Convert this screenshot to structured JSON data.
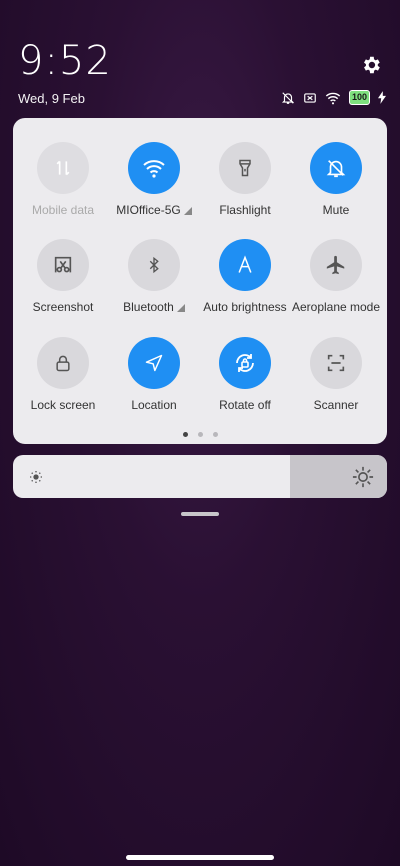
{
  "status": {
    "time": "9:52",
    "date": "Wed, 9 Feb",
    "battery": "100",
    "icons": [
      "mute-icon",
      "no-sim-icon",
      "wifi-icon",
      "battery-icon",
      "charging-icon"
    ]
  },
  "tiles": [
    {
      "label": "Mobile data",
      "icon": "mobile-data-icon",
      "state": "disabled"
    },
    {
      "label": "MIOffice-5G",
      "icon": "wifi-icon",
      "state": "on",
      "expandable": true
    },
    {
      "label": "Flashlight",
      "icon": "flashlight-icon",
      "state": "off"
    },
    {
      "label": "Mute",
      "icon": "mute-icon",
      "state": "on"
    },
    {
      "label": "Screenshot",
      "icon": "screenshot-icon",
      "state": "off"
    },
    {
      "label": "Bluetooth",
      "icon": "bluetooth-icon",
      "state": "off",
      "expandable": true
    },
    {
      "label": "Auto brightness",
      "icon": "auto-brightness-icon",
      "state": "on"
    },
    {
      "label": "Aeroplane mode",
      "icon": "airplane-icon",
      "state": "off"
    },
    {
      "label": "Lock screen",
      "icon": "lock-icon",
      "state": "off"
    },
    {
      "label": "Location",
      "icon": "location-icon",
      "state": "on"
    },
    {
      "label": "Rotate off",
      "icon": "rotate-lock-icon",
      "state": "on"
    },
    {
      "label": "Scanner",
      "icon": "scanner-icon",
      "state": "off"
    }
  ],
  "pager": {
    "pages": 3,
    "current": 1
  },
  "brightness": {
    "level": 0.74
  },
  "colors": {
    "accent": "#1f8ff3",
    "panel": "#ecebee",
    "tile_off": "#d9d8dc"
  }
}
